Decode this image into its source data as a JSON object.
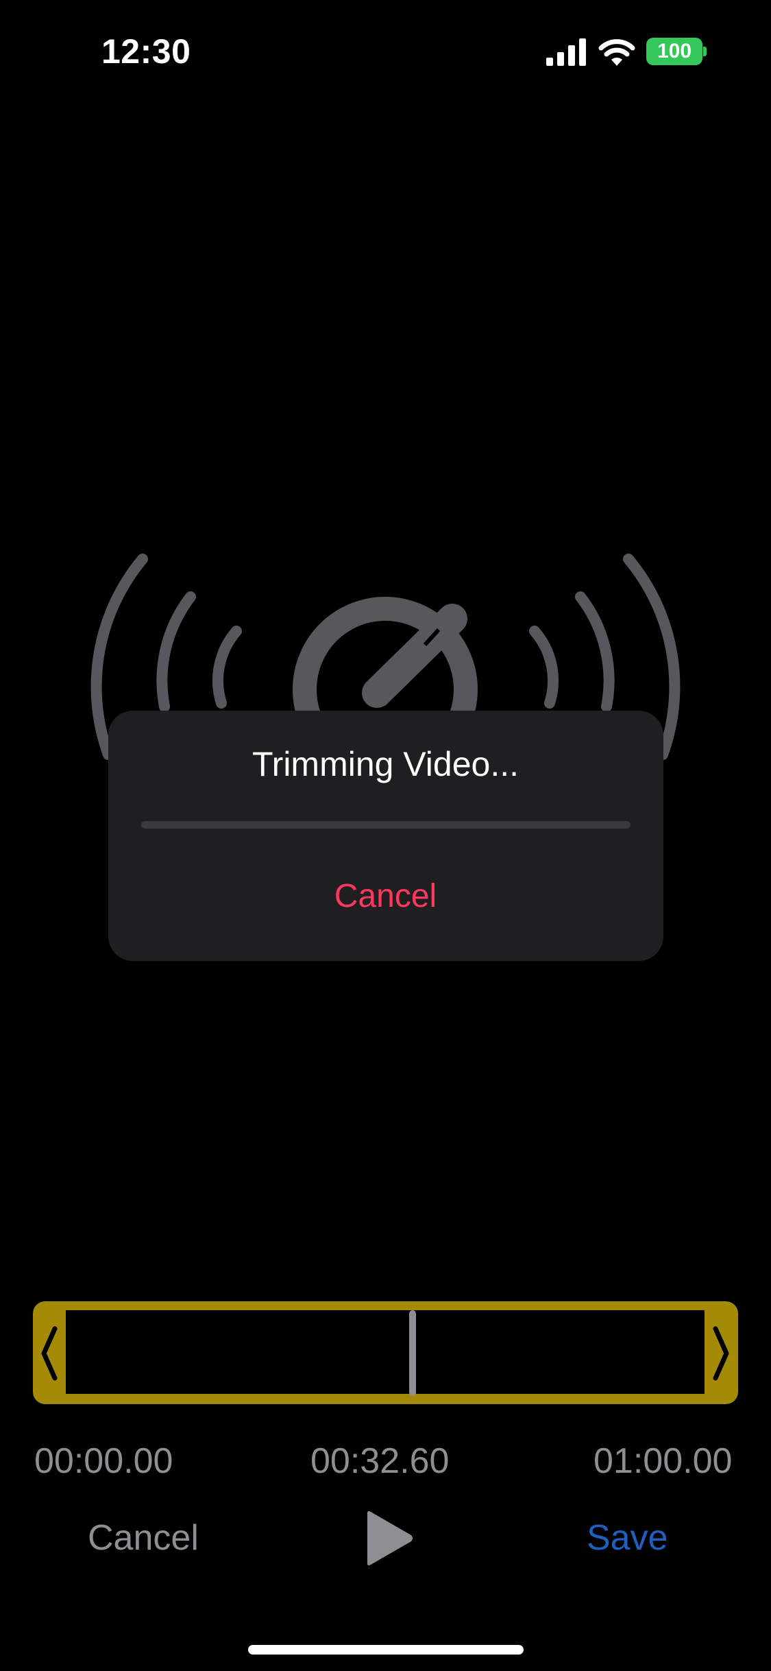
{
  "status_bar": {
    "time": "12:30",
    "battery_level": "100",
    "icons": [
      "signal-icon",
      "wifi-icon",
      "battery-icon"
    ],
    "battery_color": "#34c759"
  },
  "background_logo": {
    "icon": "quicktime-broadcast-logo-icon"
  },
  "dialog": {
    "title": "Trimming Video...",
    "progress": 0.0,
    "cancel_label": "Cancel",
    "cancel_color": "#ff375f"
  },
  "trimmer": {
    "handle_color": "#a48a07",
    "left_handle_icon": "chevron-left-icon",
    "right_handle_icon": "chevron-right-icon",
    "playhead_position": 0.543
  },
  "times": {
    "start": "00:00.00",
    "current": "00:32.60",
    "end": "01:00.00"
  },
  "toolbar": {
    "cancel_label": "Cancel",
    "play_icon": "play-icon",
    "save_label": "Save",
    "save_color": "#1f5fbf"
  }
}
